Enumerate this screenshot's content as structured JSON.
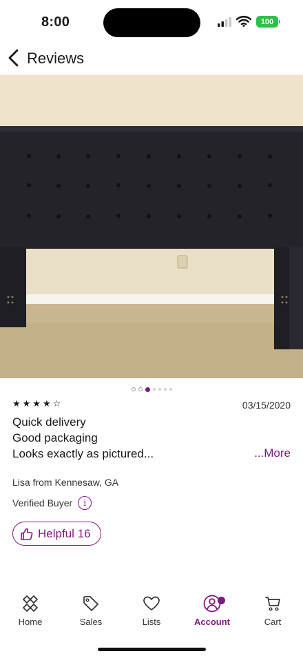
{
  "status_bar": {
    "time": "8:00",
    "battery": "100",
    "icons": [
      "signal-icon",
      "wifi-icon",
      "battery-icon"
    ]
  },
  "header": {
    "back_icon": "chevron-left-icon",
    "title": "Reviews"
  },
  "photo": {
    "alt": "product-photo-headboard"
  },
  "carousel": {
    "total_dots": 7,
    "active_index": 2
  },
  "review": {
    "rating": 4,
    "rating_max": 5,
    "stars_text": "★★★★☆",
    "date": "03/15/2020",
    "lines": [
      "Quick delivery",
      "Good packaging",
      "Looks exactly as pictured..."
    ],
    "more_label": "...More",
    "reviewer": "Lisa from Kennesaw, GA",
    "verified_label": "Verified Buyer",
    "info_glyph": "i",
    "helpful_label": "Helpful 16"
  },
  "nav": {
    "items": [
      {
        "label": "Home",
        "icon": "home-diamond-icon"
      },
      {
        "label": "Sales",
        "icon": "tag-icon"
      },
      {
        "label": "Lists",
        "icon": "heart-icon"
      },
      {
        "label": "Account",
        "icon": "account-icon"
      },
      {
        "label": "Cart",
        "icon": "cart-icon"
      }
    ],
    "active": "Account"
  },
  "colors": {
    "accent": "#7f187f",
    "battery": "#2bc24a"
  }
}
